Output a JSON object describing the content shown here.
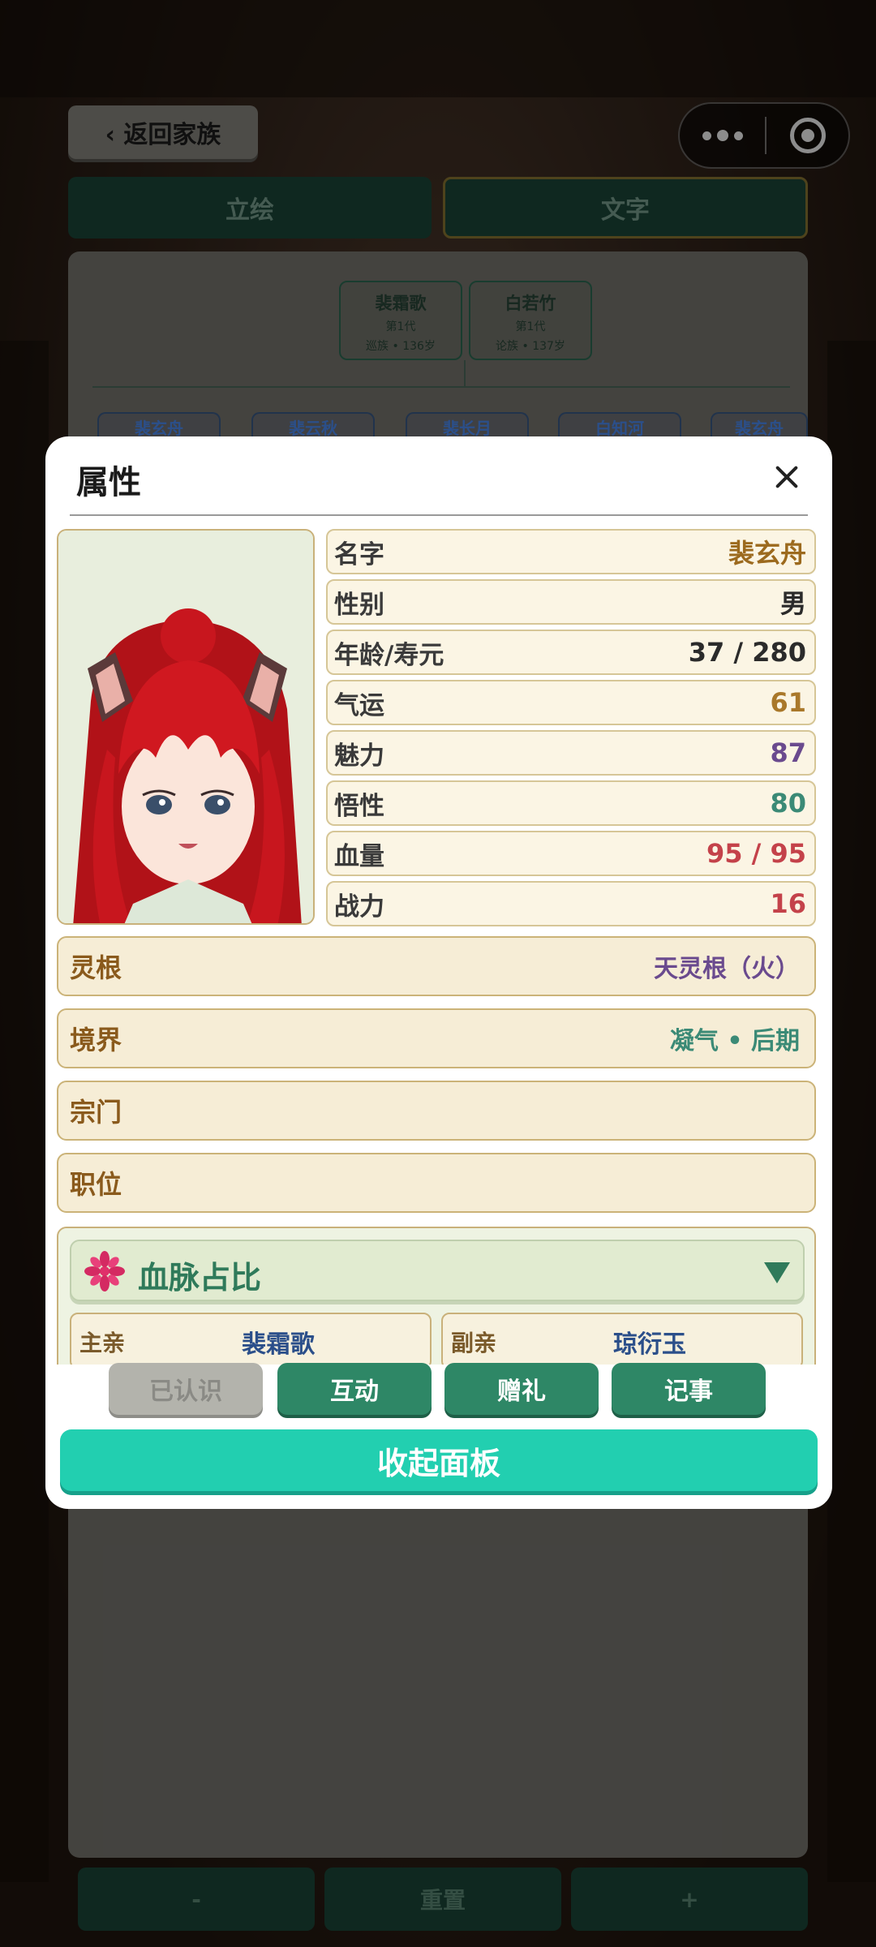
{
  "nav": {
    "back_label": "‹ 返回家族"
  },
  "tabs": [
    {
      "label": "立绘"
    },
    {
      "label": "文字"
    }
  ],
  "tree": {
    "parents": [
      {
        "name": "裴霜歌",
        "generation": "第1代",
        "info": "巡族 • 136岁"
      },
      {
        "name": "白若竹",
        "generation": "第1代",
        "info": "论族 • 137岁"
      }
    ],
    "children": [
      "裴玄舟",
      "裴云秋",
      "裴长月",
      "白知河",
      "裴玄舟"
    ]
  },
  "bottom_bar": {
    "minus": "-",
    "reset": "重置",
    "plus": "+"
  },
  "modal": {
    "title": "属性",
    "stats": [
      {
        "label": "名字",
        "value": "裴玄舟",
        "color": "#9c6a1e"
      },
      {
        "label": "性别",
        "value": "男",
        "color": "#2b2b2b"
      },
      {
        "label": "年龄/寿元",
        "value": "37 / 280",
        "color": "#2b2b2b"
      },
      {
        "label": "气运",
        "value": "61",
        "color": "#a9782a"
      },
      {
        "label": "魅力",
        "value": "87",
        "color": "#6a4a8e"
      },
      {
        "label": "悟性",
        "value": "80",
        "color": "#3b8a76"
      },
      {
        "label": "血量",
        "value": "95 / 95",
        "color": "#c4424a"
      },
      {
        "label": "战力",
        "value": "16",
        "color": "#c4424a"
      }
    ],
    "rows": [
      {
        "label": "灵根",
        "value": "天灵根（火）",
        "color": "#6a4a8e"
      },
      {
        "label": "境界",
        "value": "凝气 • 后期",
        "color": "#3b8a76"
      },
      {
        "label": "宗门",
        "value": "",
        "color": "#3b8a76"
      },
      {
        "label": "职位",
        "value": "",
        "color": "#3b8a76"
      }
    ],
    "bloodline": {
      "title": "血脉占比",
      "father_label": "主亲",
      "father_name": "裴霜歌",
      "mother_label": "副亲",
      "mother_name": "琼衍玉"
    },
    "actions": {
      "known": "已认识",
      "interact": "互动",
      "gift": "赠礼",
      "record": "记事"
    },
    "collapse": "收起面板"
  }
}
